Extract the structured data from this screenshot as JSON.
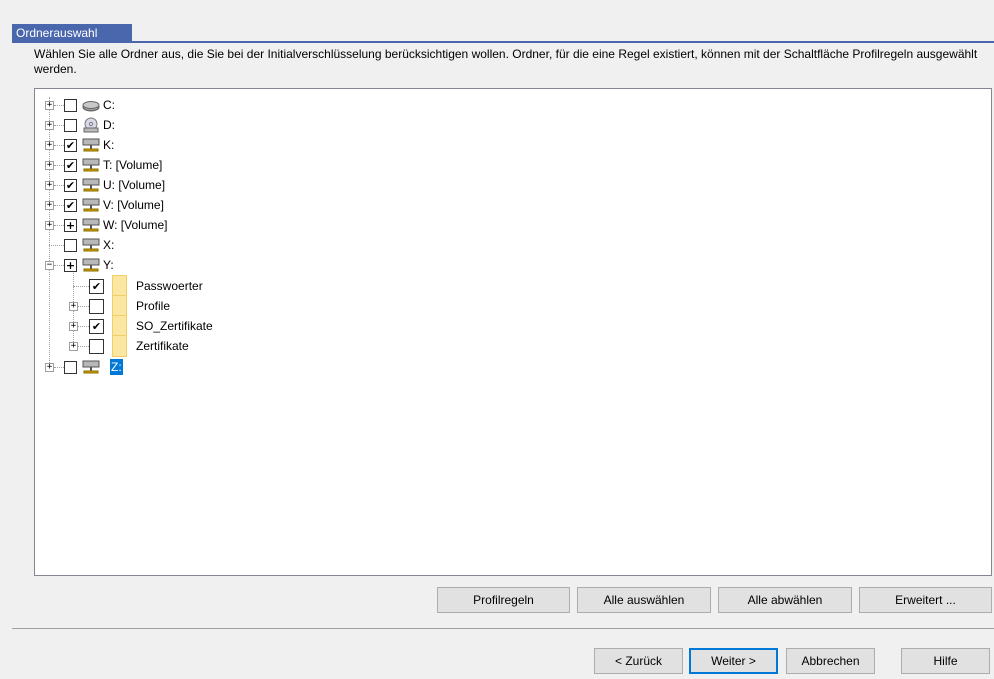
{
  "header": {
    "title": "Ordnerauswahl"
  },
  "description": "Wählen Sie alle Ordner aus, die Sie bei der Initialverschlüsselung berücksichtigen wollen. Ordner, für die eine Regel existiert, können mit der Schaltfläche Profilregeln ausgewählt werden.",
  "tree": {
    "drives": [
      {
        "label": "C:",
        "icon": "hard-drive-icon",
        "check": "unchecked",
        "expander": "+"
      },
      {
        "label": "D:",
        "icon": "cd-drive-icon",
        "check": "unchecked",
        "expander": "+"
      },
      {
        "label": "K:",
        "icon": "network-drive-icon",
        "check": "partial",
        "expander": "+"
      },
      {
        "label": "T: [Volume]",
        "icon": "network-drive-icon",
        "check": "partial",
        "expander": "+"
      },
      {
        "label": "U: [Volume]",
        "icon": "network-drive-icon",
        "check": "checked",
        "expander": "+"
      },
      {
        "label": "V: [Volume]",
        "icon": "network-drive-icon",
        "check": "partial",
        "expander": "+"
      },
      {
        "label": "W: [Volume]",
        "icon": "network-drive-icon",
        "check": "partial-plus",
        "expander": "+"
      },
      {
        "label": "X:",
        "icon": "network-drive-icon",
        "check": "unchecked",
        "expander": ""
      },
      {
        "label": "Y:",
        "icon": "network-drive-icon",
        "check": "partial-plus",
        "expander": "-"
      },
      {
        "label": "Z:",
        "icon": "network-drive-icon",
        "check": "unchecked",
        "expander": "+",
        "selected": true
      }
    ],
    "y_children": [
      {
        "label": "Passwoerter",
        "check": "checked",
        "expander": ""
      },
      {
        "label": "Profile",
        "check": "unchecked",
        "expander": "+"
      },
      {
        "label": "SO_Zertifikate",
        "check": "checked",
        "expander": "+"
      },
      {
        "label": "Zertifikate",
        "check": "unchecked",
        "expander": "+"
      }
    ]
  },
  "actions": {
    "profilregeln": "Profilregeln",
    "alle_auswaehlen": "Alle auswählen",
    "alle_abwaehlen": "Alle abwählen",
    "erweitert": "Erweitert ..."
  },
  "nav": {
    "zurueck": "< Zurück",
    "weiter": "Weiter >",
    "abbrechen": "Abbrechen",
    "hilfe": "Hilfe"
  }
}
